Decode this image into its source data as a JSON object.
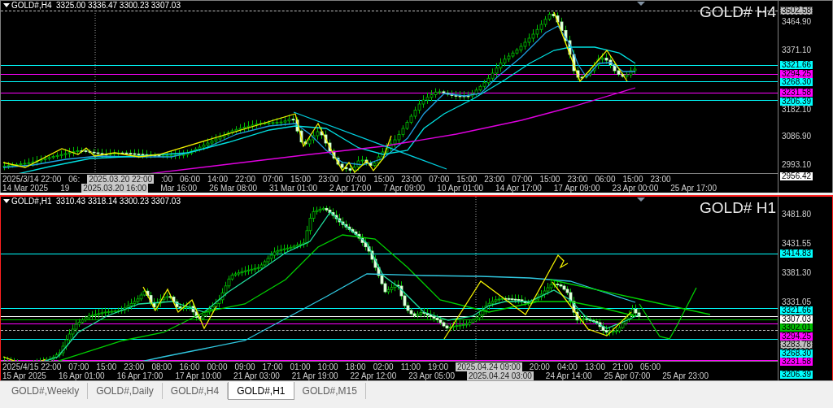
{
  "charts": [
    {
      "active": false,
      "info": "GOLD#,H4  3325.00 3336.47 3300.23 3307.03",
      "watermark": "GOLD# H4",
      "price_ticks": [
        "3464.90",
        "3371.10",
        "3182.10",
        "3086.90",
        "2993.10"
      ],
      "price_tags": [
        {
          "text": "3502.58",
          "color": "#c0c0c0",
          "dashed": true
        },
        {
          "text": "3321.66",
          "color": "#00ffff",
          "dashed": false
        },
        {
          "text": "3294.25",
          "color": "#ff00ff",
          "dashed": false
        },
        {
          "text": "3268.30",
          "color": "#00ffff",
          "dashed": false
        },
        {
          "text": "3231.58",
          "color": "#ff00ff",
          "dashed": false
        },
        {
          "text": "3206.39",
          "color": "#00ffff",
          "dashed": false
        },
        {
          "text": "2956.42",
          "color": "#ffffff"
        }
      ],
      "time_axis": [
        [
          {
            "text": "2025/3/14 22:00",
            "highlighted": false
          },
          {
            "text": "06:",
            "highlighted": false
          },
          {
            "text": "2025.03.20 22:00",
            "highlighted": true
          },
          {
            "text": ":00",
            "highlighted": false
          },
          {
            "text": "06:00",
            "highlighted": false
          },
          {
            "text": "14:00",
            "highlighted": false
          },
          {
            "text": "22:00",
            "highlighted": false
          },
          {
            "text": "07:00",
            "highlighted": false
          },
          {
            "text": "15:00",
            "highlighted": false
          },
          {
            "text": "23:00",
            "highlighted": false
          },
          {
            "text": "07:00",
            "highlighted": false
          },
          {
            "text": "15:00",
            "highlighted": false
          },
          {
            "text": "23:00",
            "highlighted": false
          },
          {
            "text": "07:00",
            "highlighted": false
          },
          {
            "text": "15:00",
            "highlighted": false
          },
          {
            "text": "23:00",
            "highlighted": false
          },
          {
            "text": "07:00",
            "highlighted": false
          },
          {
            "text": "15:00",
            "highlighted": false
          },
          {
            "text": "23:00",
            "highlighted": false
          },
          {
            "text": "06:00",
            "highlighted": false
          },
          {
            "text": "15:00",
            "highlighted": false
          },
          {
            "text": "23:00",
            "highlighted": false
          }
        ],
        [
          {
            "text": "14 Mar 2025",
            "highlighted": false
          },
          {
            "text": "19",
            "highlighted": false
          },
          {
            "text": "2025.03.20 16:00",
            "highlighted": true
          },
          {
            "text": "Mar 16:00",
            "highlighted": false
          },
          {
            "text": "26 Mar 08:00",
            "highlighted": false
          },
          {
            "text": "31 Mar 01:00",
            "highlighted": false
          },
          {
            "text": "2 Apr 17:00",
            "highlighted": false
          },
          {
            "text": "7 Apr 09:00",
            "highlighted": false
          },
          {
            "text": "10 Apr 01:00",
            "highlighted": false
          },
          {
            "text": "14 Apr 17:00",
            "highlighted": false
          },
          {
            "text": "17 Apr 09:00",
            "highlighted": false
          },
          {
            "text": "23 Apr 00:00",
            "highlighted": false
          },
          {
            "text": "25 Apr 17:00",
            "highlighted": false
          }
        ]
      ]
    },
    {
      "active": true,
      "info": "GOLD#,H1  3310.43 3318.14 3300.23 3307.03",
      "watermark": "GOLD# H1",
      "price_ticks": [
        "3481.80",
        "3431.55",
        "3381.30",
        "3331.05"
      ],
      "price_tags": [
        {
          "text": "3414.83",
          "color": "#00ffff",
          "dashed": false
        },
        {
          "text": "3321.66",
          "color": "#00ffff",
          "dashed": false
        },
        {
          "text": "3307.03",
          "color": "#ffffff",
          "dashed": false
        },
        {
          "text": "3302.01",
          "color": "#00c000",
          "dashed": false
        },
        {
          "text": "3294.25",
          "color": "#ff00ff",
          "dashed": false
        },
        {
          "text": "3283.78",
          "color": "#c0c0c0",
          "dashed": true
        },
        {
          "text": "3268.30",
          "color": "#00ffff",
          "dashed": false
        },
        {
          "text": "3231.58",
          "color": "#ff00ff",
          "dashed": false
        },
        {
          "text": "3206.39",
          "color": "#00ffff"
        }
      ],
      "time_axis": [
        [
          {
            "text": "2025/4/15 22:00",
            "highlighted": false
          },
          {
            "text": "07:00",
            "highlighted": false
          },
          {
            "text": "15:00",
            "highlighted": false
          },
          {
            "text": "23:00",
            "highlighted": false
          },
          {
            "text": "08:00",
            "highlighted": false
          },
          {
            "text": "16:00",
            "highlighted": false
          },
          {
            "text": "00:00",
            "highlighted": false
          },
          {
            "text": "09:00",
            "highlighted": false
          },
          {
            "text": "17:00",
            "highlighted": false
          },
          {
            "text": "01:00",
            "highlighted": false
          },
          {
            "text": "10:00",
            "highlighted": false
          },
          {
            "text": "18:00",
            "highlighted": false
          },
          {
            "text": "02:00",
            "highlighted": false
          },
          {
            "text": "11:00",
            "highlighted": false
          },
          {
            "text": "19:00",
            "highlighted": false
          },
          {
            "text": "2025.04.24 09:00",
            "highlighted": true
          },
          {
            "text": "20:00",
            "highlighted": false
          },
          {
            "text": "04:00",
            "highlighted": false
          },
          {
            "text": "13:00",
            "highlighted": false
          },
          {
            "text": "21:00",
            "highlighted": false
          },
          {
            "text": "05:00",
            "highlighted": false
          }
        ],
        [
          {
            "text": "15 Apr 2025",
            "highlighted": false
          },
          {
            "text": "16 Apr 01:00",
            "highlighted": false
          },
          {
            "text": "16 Apr 17:00",
            "highlighted": false
          },
          {
            "text": "17 Apr 10:00",
            "highlighted": false
          },
          {
            "text": "21 Apr 03:00",
            "highlighted": false
          },
          {
            "text": "21 Apr 19:00",
            "highlighted": false
          },
          {
            "text": "22 Apr 12:00",
            "highlighted": false
          },
          {
            "text": "23 Apr 05:00",
            "highlighted": false
          },
          {
            "text": "2025.04.24 03:00",
            "highlighted": true
          },
          {
            "text": "24 Apr 14:00",
            "highlighted": false
          },
          {
            "text": "25 Apr 07:00",
            "highlighted": false
          },
          {
            "text": "25 Apr 23:00",
            "highlighted": false
          }
        ]
      ]
    }
  ],
  "tabs": [
    {
      "label": "GOLD#,Weekly",
      "selected": false
    },
    {
      "label": "GOLD#,Daily",
      "selected": false
    },
    {
      "label": "GOLD#,H4",
      "selected": false
    },
    {
      "label": "GOLD#,H1",
      "selected": true
    },
    {
      "label": "GOLD#,M15",
      "selected": false
    }
  ]
}
